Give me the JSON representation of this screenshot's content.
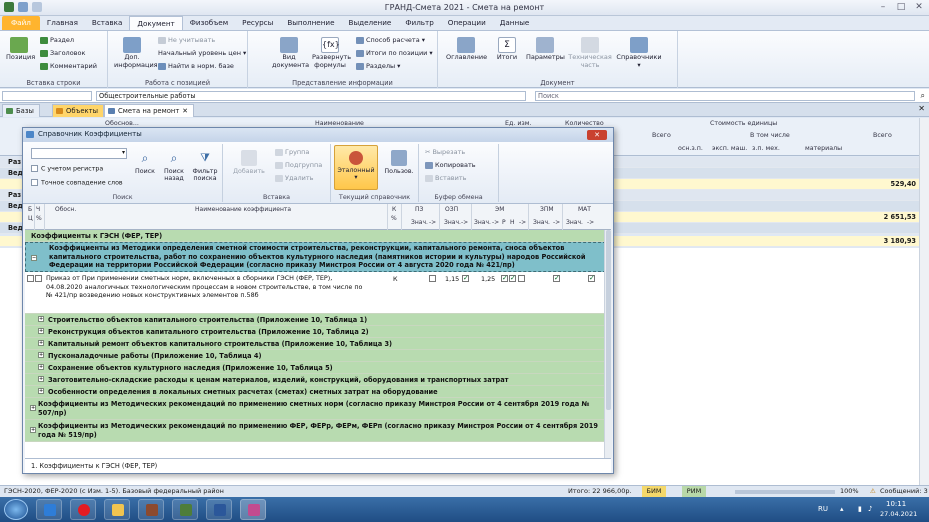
{
  "window": {
    "title": "ГРАНД-Смета 2021 - Смета на ремонт"
  },
  "menu": {
    "items": [
      "Файл",
      "Главная",
      "Вставка",
      "Документ",
      "Физобъем",
      "Ресурсы",
      "Выполнение",
      "Выделение",
      "Фильтр",
      "Операции",
      "Данные"
    ],
    "active_index": 3
  },
  "ribbon": {
    "groups": {
      "insert_row": "Вставка строки",
      "position_work": "Работа с позицией",
      "presentation": "Представление информации",
      "document": "Документ"
    },
    "buttons": {
      "position": "Позиция",
      "razdel": "Раздел",
      "zagolovok": "Заголовок",
      "comment": "Комментарий",
      "dop_info_1": "Доп.",
      "dop_info_2": "информация",
      "ne_uchityvat": "Не учитывать",
      "start_level": "Начальный уровень цен",
      "find_in_base": "Найти в норм. базе",
      "view_1": "Вид",
      "view_2": "документа",
      "expand_1": "Развернуть",
      "expand_2": "формулы",
      "calc_method": "Способ расчета",
      "totals_by_pos": "Итоги по позиции",
      "sections": "Разделы",
      "contents": "Оглавление",
      "totals": "Итоги",
      "params": "Параметры",
      "tech_1": "Техническая",
      "tech_2": "часть",
      "refs": "Справочники"
    }
  },
  "formula_bar": {
    "cell_ref": "",
    "value": "Общестроительные работы",
    "search_placeholder": "Поиск"
  },
  "doc_tabs": [
    "Базы",
    "Объекты",
    "Смета на ремонт"
  ],
  "bg": {
    "headers": {
      "obosn": "Обоснов...",
      "name": "Наименование",
      "unit": "Ед. изм.",
      "qty": "Количество",
      "cost": "Стоимость единицы",
      "total": "Всего",
      "incl": "В том числе",
      "ozp": "осн.з.п.",
      "em": "эксп. маш.",
      "zpmeh": "з.п. мех.",
      "mat": "материалы",
      "total2": "Всего"
    },
    "rows": [
      {
        "label": "Раз",
        "value": ""
      },
      {
        "label": "Вед",
        "value": ""
      },
      {
        "label": "",
        "value": "529,40"
      },
      {
        "label": "Раз",
        "value": ""
      },
      {
        "label": "Вед",
        "value": ""
      },
      {
        "label": "",
        "value": "2 651,53"
      },
      {
        "label": "Вед",
        "value": ""
      },
      {
        "label": "",
        "value": "3 180,93"
      }
    ]
  },
  "dialog": {
    "title": "Справочник Коэффициенты",
    "close_label": "✕",
    "search_combo": "",
    "check_register": "С учетом регистра",
    "check_exact": "Точное совпадение слов",
    "btn_search": "Поиск",
    "btn_search_back_1": "Поиск",
    "btn_search_back_2": "назад",
    "btn_filter_1": "Фильтр",
    "btn_filter_2": "поиска",
    "g_search": "Поиск",
    "btn_add": "Добавить",
    "btn_group": "Группа",
    "btn_subgroup": "Подгруппа",
    "btn_delete": "Удалить",
    "g_insert": "Вставка",
    "btn_etalon": "Эталонный",
    "btn_user": "Пользов.",
    "g_current": "Текущий справочник",
    "btn_cut": "Вырезать",
    "btn_copy": "Копировать",
    "btn_paste": "Вставить",
    "g_buffer": "Буфер обмена",
    "cols": {
      "b": "Б",
      "c": "Ц",
      "ch": "Ч",
      "obosn": "Обосн.",
      "name": "Наименование коэффициента",
      "kpct_1": "К",
      "kpct_2": "%",
      "pz": "ПЗ",
      "ozp": "ОЗП",
      "em": "ЭМ",
      "zpm": "ЗПМ",
      "mat": "МАТ",
      "znach": "Знач.",
      "arrow": "->",
      "r": "Р",
      "n": "Н"
    },
    "rows": [
      {
        "text": "Коэффициенты к ГЭСН (ФЕР, ТЕР)",
        "style": "green"
      },
      {
        "text": "Коэффициенты из Методики определения сметной стоимости строительства, реконструкции, капитального ремонта, сноса объектов капитального строительства, работ по сохранению объектов культурного наследия (памятников истории и культуры) народов Российской Федерации на территории Российской Федерации (согласно приказу Минстроя России от 4 августа 2020 года № 421/пр)",
        "style": "teal"
      },
      {
        "text": "Приказ от При применении сметных норм, включенных в сборники ГЭСН (ФЕР, ТЕР), 04.08.2020 аналогичных технологическим процессам в новом строительстве, в том числе по № 421/пр возведению новых конструктивных элементов п.58б",
        "style": "white",
        "k": "К",
        "ozp_val": "1,15",
        "em_val": "1,25"
      },
      {
        "text": "Строительство объектов капитального строительства (Приложение 10, Таблица 1)",
        "style": "green"
      },
      {
        "text": "Реконструкция объектов капитального строительства (Приложение 10, Таблица 2)",
        "style": "green"
      },
      {
        "text": "Капитальный ремонт объектов капитального строительства (Приложение 10, Таблица 3)",
        "style": "green"
      },
      {
        "text": "Пусконаладочные работы (Приложение 10, Таблица 4)",
        "style": "green"
      },
      {
        "text": "Сохранение объектов культурного наследия (Приложение 10, Таблица 5)",
        "style": "green"
      },
      {
        "text": "Заготовительно-складские расходы к ценам материалов, изделий, конструкций, оборудования и транспортных затрат",
        "style": "green"
      },
      {
        "text": "Особенности определения в локальных сметных расчетах (сметах) сметных затрат на оборудование",
        "style": "green"
      },
      {
        "text": "Коэффициенты из Методических рекомендаций по применению сметных норм (согласно приказу Минстроя России от 4 сентября 2019 года № 507/пр)",
        "style": "green"
      },
      {
        "text": "Коэффициенты из Методических рекомендаций по применению ФЕР, ФЕРр, ФЕРм, ФЕРп (согласно приказу Минстроя России от 4 сентября 2019 года № 519/пр)",
        "style": "green"
      }
    ],
    "status": "1. Коэффициенты к ГЭСН (ФЕР, ТЕР)"
  },
  "status_bar": {
    "left": "ГЭСН-2020, ФЕР-2020 (с Изм. 1-5). Базовый федеральный район",
    "total": "Итого: 22 966,00р.",
    "bim": "БИМ",
    "rim": "РИМ",
    "zoom": "100%",
    "messages": "Сообщений: 3"
  },
  "taskbar": {
    "lang": "RU",
    "time": "10:11",
    "date": "27.04.2021"
  },
  "colors": {
    "accent_file": "#ffb42e",
    "green_row": "#b8dbb0",
    "teal_row": "#7fbfca",
    "taskbar": "#1f4d84"
  }
}
